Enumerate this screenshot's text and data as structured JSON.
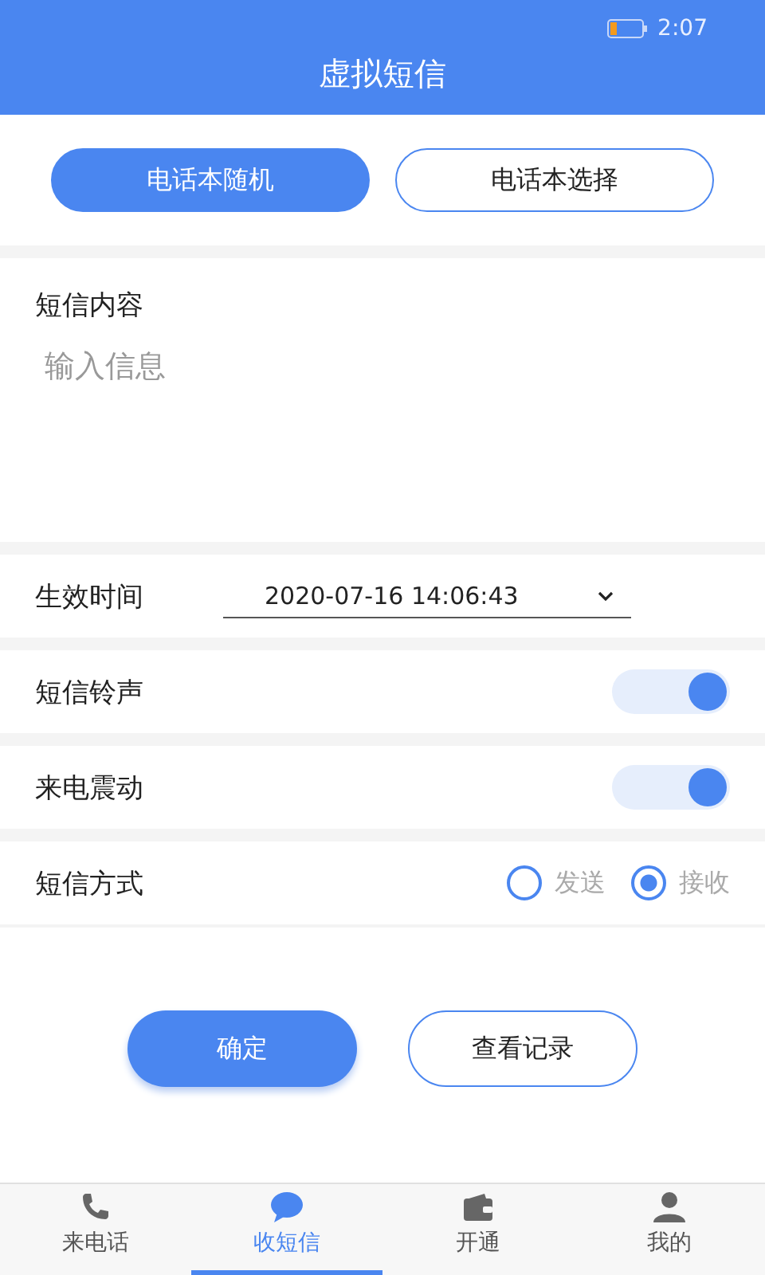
{
  "status_bar": {
    "time": "2:07"
  },
  "header": {
    "title": "虚拟短信"
  },
  "mode_buttons": [
    {
      "label": "电话本随机",
      "selected": true
    },
    {
      "label": "电话本选择",
      "selected": false
    }
  ],
  "message": {
    "label": "短信内容",
    "placeholder": "输入信息"
  },
  "settings": [
    {
      "kind": "datetime",
      "label": "生效时间",
      "value": "2020-07-16 14:06:43"
    },
    {
      "kind": "switch",
      "label": "短信铃声",
      "on": true
    },
    {
      "kind": "switch",
      "label": "来电震动",
      "on": true
    },
    {
      "kind": "radio",
      "label": "短信方式",
      "options": [
        {
          "label": "发送",
          "selected": false
        },
        {
          "label": "接收",
          "selected": true
        }
      ]
    }
  ],
  "actions": [
    {
      "label": "确定",
      "kind": "primary"
    },
    {
      "label": "查看记录",
      "kind": "outline"
    }
  ],
  "tabs": [
    {
      "label": "来电话",
      "kind": "phone",
      "selected": false
    },
    {
      "label": "收短信",
      "kind": "chat",
      "selected": true
    },
    {
      "label": "开通",
      "kind": "wallet",
      "selected": false
    },
    {
      "label": "我的",
      "kind": "person",
      "selected": false
    }
  ]
}
